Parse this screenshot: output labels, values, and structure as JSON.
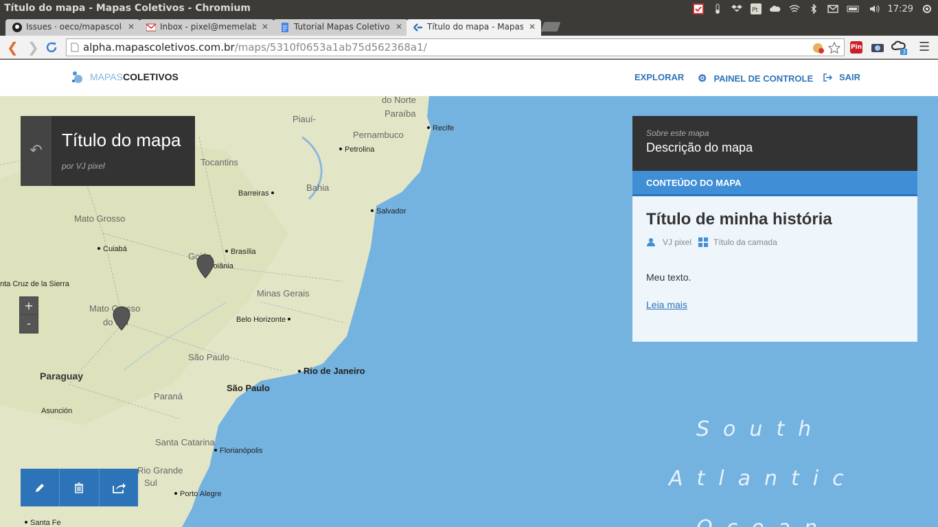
{
  "window": {
    "title": "Título do mapa - Mapas Coletivos - Chromium",
    "clock": "17:29"
  },
  "tabs": [
    {
      "label": "Issues · oeco/mapascoletiv",
      "icon": "github-icon"
    },
    {
      "label": "Inbox - pixel@memelab.co",
      "icon": "gmail-icon"
    },
    {
      "label": "Tutorial Mapas Coletivos -",
      "icon": "docs-icon"
    },
    {
      "label": "Título do mapa - Mapas Co",
      "icon": "mapascoletivos-icon",
      "active": true
    }
  ],
  "omnibox": {
    "host": "alpha.mapascoletivos.com.br",
    "path": "/maps/5310f0653a1ab75d562368a1/"
  },
  "extensions": {
    "pin_label": "Pin",
    "badge": "3"
  },
  "site": {
    "logo_light": "MAPAS",
    "logo_bold": "COLETIVOS",
    "nav": {
      "explore": "EXPLORAR",
      "dashboard": "PAINEL DE CONTROLE",
      "logout": "SAIR"
    }
  },
  "map": {
    "title": "Título do mapa",
    "author": "por VJ pixel",
    "zoom_in": "+",
    "zoom_out": "-",
    "labels": {
      "do_norte": "do Norte",
      "paraiba": "Paraíba",
      "piaui": "Piauí-",
      "pernambuco": "Pernambuco",
      "recife": "Recife",
      "petrolina": "Petrolina",
      "tocantins": "Tocantins",
      "bahia": "Bahia",
      "barreiras": "Barreiras",
      "salvador": "Salvador",
      "mato_grosso": "Mato Grosso",
      "cuiaba": "Cuiabá",
      "brasilia": "Brasília",
      "goias": "Goiás",
      "goiania": "Goiânia",
      "santa_cruz": "nta Cruz de la Sierra",
      "minas_gerais": "Minas Gerais",
      "mato_grosso_sul_1": "Mato Grosso",
      "mato_grosso_sul_2": "do Sul",
      "belo_horizonte": "Belo Horizonte",
      "sao_paulo_state": "São Paulo",
      "rio": "Rio de Janeiro",
      "paraguay": "Paraguay",
      "sao_paulo_city": "São Paulo",
      "parana": "Paraná",
      "asuncion": "Asunción",
      "santa_catarina": "Santa Catarina",
      "florianopolis": "Florianópolis",
      "rio_grande_1": "Rio Grande",
      "rio_grande_2": "Sul",
      "porto_alegre": "Porto Alegre",
      "santa_fe": "Santa Fe"
    },
    "ocean": [
      "South",
      "Atlantic",
      "Ocean"
    ],
    "colors": {
      "ocean": "#74b2e0",
      "land": "#e3e6c6",
      "accent": "#2d73b8"
    }
  },
  "panel": {
    "about_label": "Sobre este mapa",
    "description": "Descrição do mapa",
    "content_label": "CONTEÚDO DO MAPA",
    "story": {
      "title": "Título de minha história",
      "author": "VJ pixel",
      "layer": "Título da camada",
      "text": "Meu texto.",
      "read_more": "Leia mais"
    }
  }
}
